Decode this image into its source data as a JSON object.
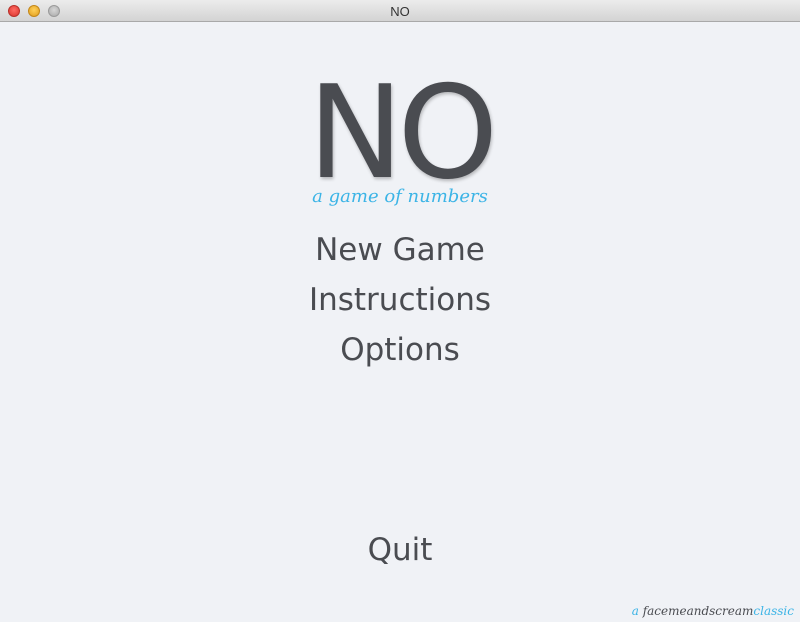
{
  "window": {
    "title": "NO"
  },
  "game": {
    "logo": "NO",
    "subtitle": "a game of numbers"
  },
  "menu": {
    "new_game": "New Game",
    "instructions": "Instructions",
    "options": "Options",
    "quit": "Quit"
  },
  "credit": {
    "prefix": "a ",
    "studio": "facemeandscream",
    "suffix": "classic"
  },
  "colors": {
    "background": "#f0f2f6",
    "text": "#4a4c51",
    "accent": "#3cb4e6"
  }
}
